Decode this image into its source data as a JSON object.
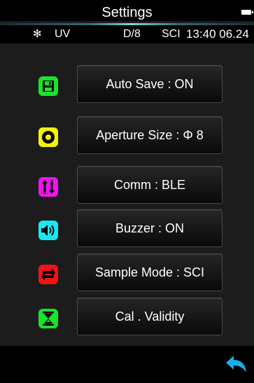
{
  "header": {
    "title": "Settings",
    "battery_icon": "battery-icon"
  },
  "status_bar": {
    "bluetooth_icon": "bluetooth-icon",
    "bluetooth_glyph": "✻",
    "uv": "UV",
    "geometry": "D/8",
    "mode": "SCI",
    "time": "13:40 06.24"
  },
  "settings": [
    {
      "label": "Auto Save : ON",
      "icon": "save-icon",
      "color": "#19e32c"
    },
    {
      "label": "Aperture Size : Φ 8",
      "icon": "aperture-icon",
      "color": "#f2f20f"
    },
    {
      "label": "Comm : BLE",
      "icon": "transfer-icon",
      "color": "#f013f0"
    },
    {
      "label": "Buzzer : ON",
      "icon": "speaker-icon",
      "color": "#18e8f0"
    },
    {
      "label": "Sample Mode : SCI",
      "icon": "cycle-icon",
      "color": "#ee1414"
    },
    {
      "label": "Cal . Validity",
      "icon": "hourglass-icon",
      "color": "#19e32c"
    }
  ],
  "footer": {
    "back_icon": "back-icon",
    "back_color": "#19aee8"
  }
}
